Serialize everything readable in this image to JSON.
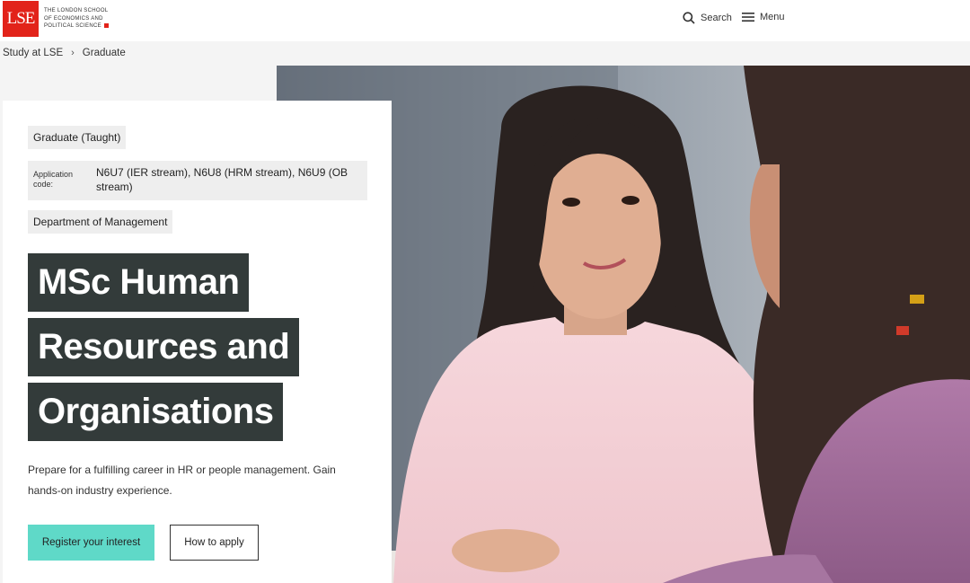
{
  "header": {
    "logo_mark": "LSE",
    "logo_lines": [
      "The London School",
      "of Economics and",
      "Political Science"
    ],
    "search_label": "Search",
    "menu_label": "Menu"
  },
  "breadcrumb": {
    "items": [
      "Study at LSE",
      "Graduate"
    ],
    "separator": "›"
  },
  "programme": {
    "level": "Graduate (Taught)",
    "application_code_label": "Application code:",
    "application_code_value": "N6U7 (IER stream), N6U8 (HRM stream), N6U9 (OB stream)",
    "department": "Department of Management",
    "title_lines": [
      "MSc Human",
      "Resources and",
      "Organisations"
    ],
    "description": "Prepare for a fulfilling career in HR or people management. Gain hands-on industry experience.",
    "primary_cta": "Register your interest",
    "secondary_cta": "How to apply"
  },
  "colors": {
    "brand_red": "#e2231a",
    "title_bg": "#333b3a",
    "cta_teal": "#5fd9c8"
  }
}
